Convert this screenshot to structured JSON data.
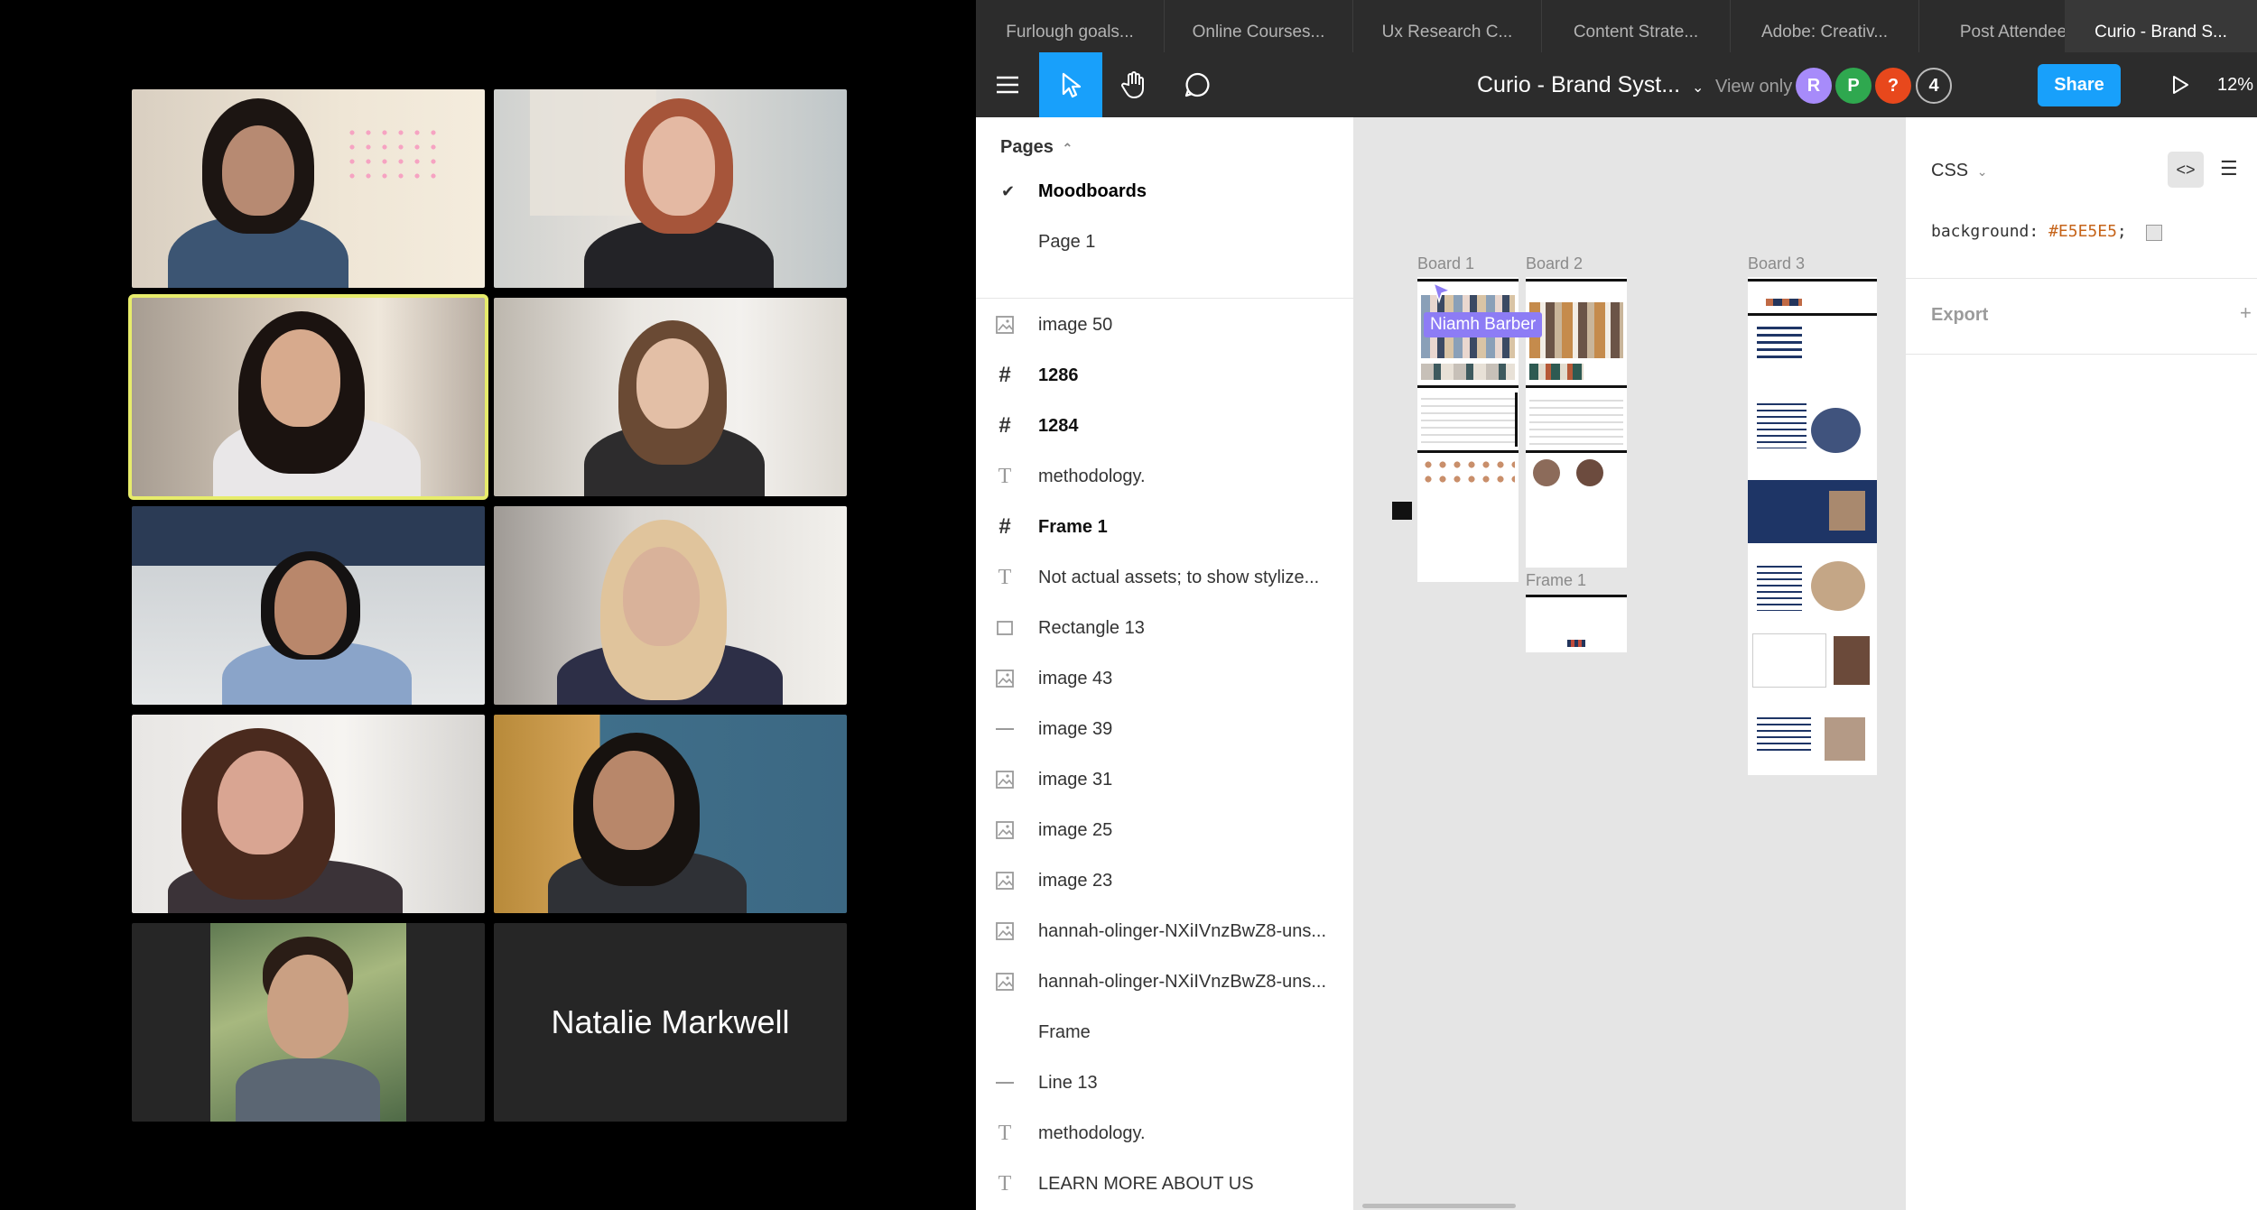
{
  "video_call": {
    "participants": [
      {
        "id": "p1"
      },
      {
        "id": "p2"
      },
      {
        "id": "p3",
        "speaking": true
      },
      {
        "id": "p4"
      },
      {
        "id": "p5"
      },
      {
        "id": "p6"
      },
      {
        "id": "p7"
      },
      {
        "id": "p8"
      },
      {
        "id": "p9"
      },
      {
        "id": "p10",
        "name": "Natalie Markwell",
        "video_off": true
      }
    ]
  },
  "tabs": [
    {
      "label": "Furlough goals..."
    },
    {
      "label": "Online Courses..."
    },
    {
      "label": "Ux Research C..."
    },
    {
      "label": "Content Strate..."
    },
    {
      "label": "Adobe: Creativ..."
    },
    {
      "label": "Post Attendee"
    },
    {
      "label": "Curio - Brand S...",
      "active": true
    }
  ],
  "toolbar": {
    "file_title": "Curio - Brand Syst...",
    "view_only": "View only",
    "avatars": [
      {
        "initial": "R",
        "color": "#a78bfa"
      },
      {
        "initial": "P",
        "color": "#2fa84f"
      },
      {
        "initial": "?",
        "color": "#e8481c"
      },
      {
        "initial": "4",
        "color": "#2c2c2c"
      }
    ],
    "share_label": "Share",
    "zoom": "12%"
  },
  "pages": {
    "header": "Pages",
    "items": [
      {
        "label": "Moodboards",
        "current": true,
        "check": "✔"
      },
      {
        "label": "Page 1",
        "current": false
      }
    ]
  },
  "layers": [
    {
      "type": "image",
      "label": "image 50"
    },
    {
      "type": "frame",
      "label": "1286"
    },
    {
      "type": "frame",
      "label": "1284"
    },
    {
      "type": "text",
      "label": "methodology."
    },
    {
      "type": "frame",
      "label": "Frame 1"
    },
    {
      "type": "text",
      "label": "Not actual assets; to show stylize..."
    },
    {
      "type": "rect",
      "label": "Rectangle 13"
    },
    {
      "type": "image",
      "label": "image 43"
    },
    {
      "type": "line",
      "label": "image 39"
    },
    {
      "type": "image",
      "label": "image 31"
    },
    {
      "type": "image",
      "label": "image 25"
    },
    {
      "type": "image",
      "label": "image 23"
    },
    {
      "type": "image",
      "label": "hannah-olinger-NXiIVnzBwZ8-uns..."
    },
    {
      "type": "image",
      "label": "hannah-olinger-NXiIVnzBwZ8-uns..."
    },
    {
      "type": "plain",
      "label": "Frame"
    },
    {
      "type": "line",
      "label": "Line 13"
    },
    {
      "type": "text",
      "label": "methodology."
    },
    {
      "type": "text",
      "label": "LEARN MORE ABOUT US"
    }
  ],
  "canvas": {
    "boards": [
      {
        "label": "Board 1"
      },
      {
        "label": "Board 2"
      },
      {
        "label": "Board 3"
      },
      {
        "label": "Frame 1"
      }
    ],
    "cursor_user": "Niamh Barber"
  },
  "properties": {
    "css_label": "CSS",
    "css_property": "background:",
    "css_value": "#E5E5E5",
    "css_end": ";",
    "export_label": "Export",
    "help": "?"
  }
}
